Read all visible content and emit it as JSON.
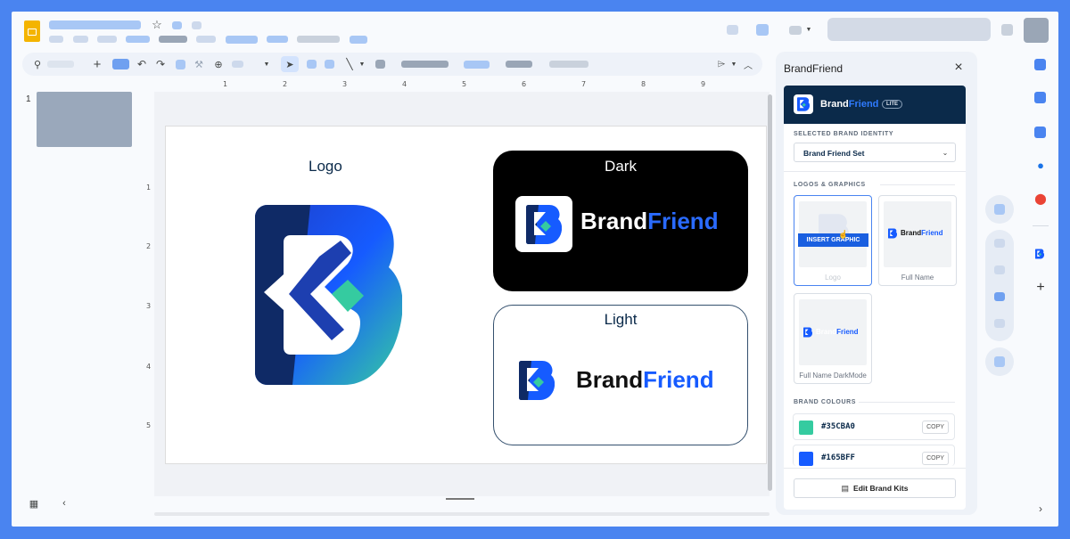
{
  "panel": {
    "title": "BrandFriend",
    "brand_name_part1": "Brand",
    "brand_name_part2": "Friend",
    "tier_badge": "LITE",
    "selected_label": "SELECTED BRAND IDENTITY",
    "selected_value": "Brand Friend Set",
    "logos_label": "LOGOS & GRAPHICS",
    "insert_label": "INSERT GRAPHIC",
    "cards": [
      {
        "caption": "Logo"
      },
      {
        "caption": "Full Name"
      },
      {
        "caption": "Full Name DarkMode"
      }
    ],
    "colours_label": "BRAND COLOURS",
    "colours": [
      {
        "hex": "#35CBA0",
        "copy": "COPY"
      },
      {
        "hex": "#165BFF",
        "copy": "COPY"
      }
    ],
    "edit_button": "Edit Brand Kits"
  },
  "slide": {
    "logo_heading": "Logo",
    "dark_heading": "Dark",
    "light_heading": "Light",
    "brand_part1": "Brand",
    "brand_part2": "Friend"
  },
  "filmstrip": {
    "slide_number": "1"
  },
  "ruler": {
    "h": [
      "1",
      "2",
      "3",
      "4",
      "5",
      "6",
      "7",
      "8",
      "9"
    ],
    "v": [
      "1",
      "2",
      "3",
      "4",
      "5"
    ]
  },
  "colors": {
    "navy": "#0b2a4a",
    "green": "#35CBA0",
    "blue": "#165BFF",
    "accent": "#1a73e8"
  }
}
